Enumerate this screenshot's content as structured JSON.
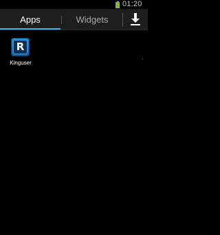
{
  "status_bar": {
    "time": "01:20",
    "battery_icon": "battery-icon",
    "battery_color": "#6fbf3a"
  },
  "tabs": {
    "apps_label": "Apps",
    "widgets_label": "Widgets",
    "active": "Apps",
    "accent_color": "#33b5e5",
    "download_icon": "download-icon"
  },
  "apps": [
    {
      "label": "Kinguser",
      "icon_letter": "R",
      "icon": "kinguser-app-icon"
    }
  ]
}
